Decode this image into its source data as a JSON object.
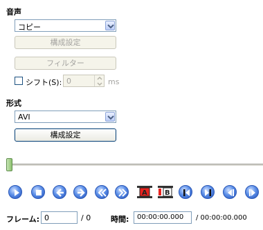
{
  "audio": {
    "section_label": "音声",
    "codec_value": "コピー",
    "settings_button": "構成設定",
    "filter_button": "フィルター",
    "shift_label": "シフト(S):",
    "shift_value": "0",
    "shift_unit": "ms"
  },
  "format": {
    "section_label": "形式",
    "container_value": "AVI",
    "settings_button": "構成設定"
  },
  "timeline": {
    "position_fraction": 0.0
  },
  "status": {
    "frame_label": "フレーム:",
    "frame_value": "0",
    "frame_total": "/ 0",
    "time_label": "時間:",
    "time_value": "00:00:00.000",
    "time_total": "/ 00:00:00.000"
  },
  "controls": {
    "icons": [
      "play-icon",
      "stop-icon",
      "previous-frame-icon",
      "next-frame-icon",
      "rewind-icon",
      "fast-forward-icon",
      "marker-a-icon",
      "marker-b-icon",
      "goto-start-icon",
      "goto-end-icon",
      "previous-keyframe-icon",
      "next-keyframe-icon"
    ]
  },
  "colors": {
    "accent_blue": "#2451b9",
    "marker_red": "#e8231f",
    "field_border": "#7f9db9"
  }
}
